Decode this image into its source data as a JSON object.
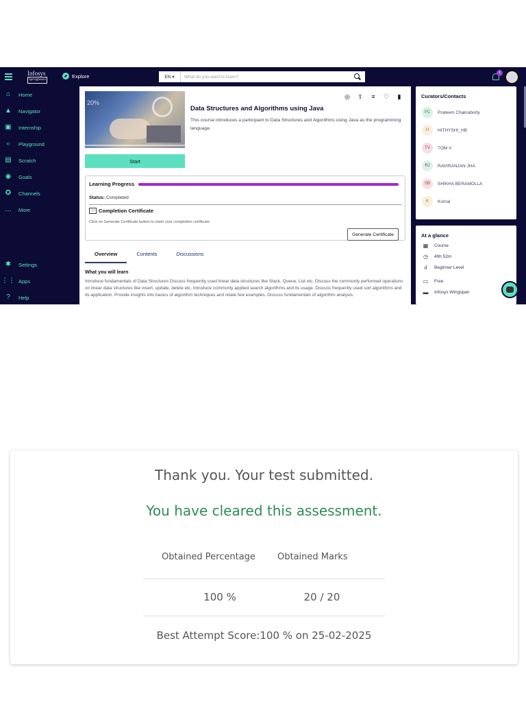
{
  "app": {
    "logo_text": "Infosys",
    "logo_sub": "Springboard",
    "explore_label": "Explore",
    "language": "EN",
    "search_placeholder": "What do you want to learn?",
    "notification_count": "1"
  },
  "sidebar": {
    "items": [
      {
        "label": "Home",
        "icon": "home-icon"
      },
      {
        "label": "Navigator",
        "icon": "navigator-icon"
      },
      {
        "label": "Internship",
        "icon": "briefcase-icon"
      },
      {
        "label": "Playground",
        "icon": "code-icon"
      },
      {
        "label": "Scratch",
        "icon": "scratch-icon"
      },
      {
        "label": "Goals",
        "icon": "target-icon"
      },
      {
        "label": "Channels",
        "icon": "channels-icon"
      },
      {
        "label": "More",
        "icon": "more-icon"
      }
    ],
    "bottom_items": [
      {
        "label": "Settings",
        "icon": "gear-icon"
      },
      {
        "label": "Apps",
        "icon": "apps-grid-icon"
      },
      {
        "label": "Help",
        "icon": "help-icon"
      }
    ]
  },
  "course": {
    "thumb_text": "20%",
    "title": "Data Structures and Algorithms using Java",
    "description": "This course introduces a participant to Data Structures and Algorithms using Java as the programming language.",
    "start_label": "Start",
    "progress_label": "Learning Progress",
    "progress_value": 1.0,
    "status_label": "Status:",
    "status_value": "Completed",
    "cert_title": "Completion Certificate",
    "cert_note": "Click on Generate Certificate button to claim your completion certificate",
    "generate_label": "Generate Certificate",
    "tabs": [
      "Overview",
      "Contents",
      "Discussions"
    ],
    "learn_heading": "What you will learn",
    "learn_text": "Introduce fundamentals of Data Structures Discuss frequently used linear data structures like Stack, Queue, List etc. Discuss the commonly performed operations on linear data structures like insert, update, delete etc. Introduce commonly applied search algorithms and its usage. Discuss frequently used sort algorithms and its application. Provide insights into basics of algorithm techniques and relate few examples. Discuss fundamentals of algorithm analysis."
  },
  "curators": {
    "heading": "Curators/Contacts",
    "people": [
      {
        "initials": "PC",
        "name": "Prateem Chakraborty",
        "bg": "#d8f2e4",
        "fg": "#2e8b57"
      },
      {
        "initials": "H",
        "name": "HITHYSHI_HB",
        "bg": "#fbeedd",
        "fg": "#b07030"
      },
      {
        "initials": "TV",
        "name": "TOM V",
        "bg": "#f6dde6",
        "fg": "#a04060"
      },
      {
        "initials": "RJ",
        "name": "RAVIRANJAN JHA",
        "bg": "#dff0ee",
        "fg": "#2a6a60"
      },
      {
        "initials": "SB",
        "name": "SHIKHA BERAMOLLA",
        "bg": "#f8dfe0",
        "fg": "#a04040"
      },
      {
        "initials": "K",
        "name": "Komal",
        "bg": "#f6f0da",
        "fg": "#9a8030"
      }
    ]
  },
  "glance": {
    "heading": "At a glance",
    "items": [
      {
        "label": "Course",
        "icon": "grid-icon"
      },
      {
        "label": "49h 52m",
        "icon": "clock-icon"
      },
      {
        "label": "Beginner Level",
        "icon": "level-icon"
      },
      {
        "label": "Free",
        "icon": "card-icon"
      },
      {
        "label": "Infosys Wingspan",
        "icon": "folder-icon"
      }
    ]
  },
  "result": {
    "thanks": "Thank you. Your test submitted.",
    "cleared": "You have cleared this assessment.",
    "col1_header": "Obtained Percentage",
    "col2_header": "Obtained Marks",
    "percentage": "100 %",
    "marks": "20 / 20",
    "best_attempt": "Best Attempt Score:100 % on 25-02-2025",
    "cleared_color": "#2e8b57"
  }
}
